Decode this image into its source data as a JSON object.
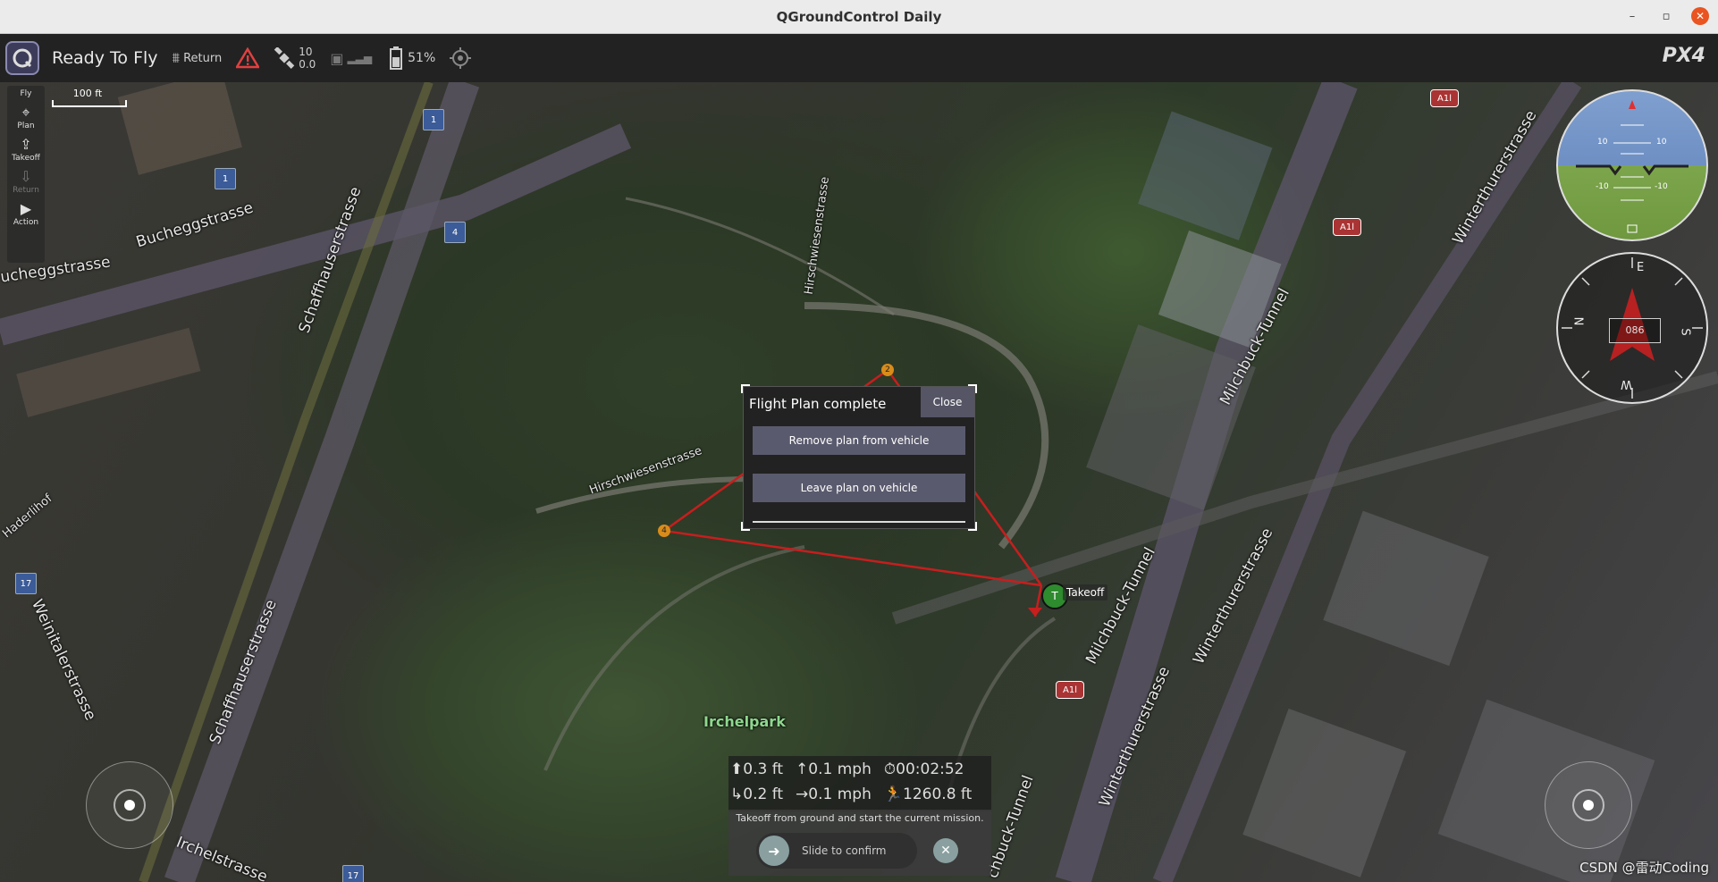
{
  "window": {
    "title": "QGroundControl Daily"
  },
  "toolbar": {
    "status": "Ready To Fly",
    "return_label": "Return",
    "satellite_count": "10",
    "satellite_hdop": "0.0",
    "battery_percent": "51%"
  },
  "fly_tools": [
    {
      "label": "Fly",
      "icon": "fly-icon",
      "enabled": true
    },
    {
      "label": "Plan",
      "icon": "plan-icon",
      "enabled": true
    },
    {
      "label": "Takeoff",
      "icon": "takeoff-icon",
      "enabled": true
    },
    {
      "label": "Return",
      "icon": "return-icon",
      "enabled": false
    },
    {
      "label": "Action",
      "icon": "action-icon",
      "enabled": true
    }
  ],
  "scale": {
    "label": "100 ft"
  },
  "map": {
    "streets": [
      "Bucheggstrasse",
      "ucheggstrasse",
      "Schaffhauserstrasse",
      "Schaffhauserstrasse",
      "Hirschwiesenstrasse",
      "Hirschwiesenstrasse",
      "Milchbuck-Tunnel",
      "Milchbuck-Tunnel",
      "Winterthurerstrasse",
      "Winterthurerstrasse",
      "Winterthurerstrasse",
      "Weinitalerstrasse",
      "Haderlihof",
      "Irchelstrasse",
      "chbuck-Tunnel"
    ],
    "park_label": "Irchelpark",
    "badges_blue": [
      "1",
      "1",
      "4",
      "17",
      "17"
    ],
    "badges_red": [
      "A1l",
      "A1l",
      "A1l"
    ],
    "waypoints": [
      "2",
      "4"
    ],
    "takeoff": {
      "marker": "T",
      "label": "Takeoff"
    }
  },
  "instruments": {
    "pitch_marks": [
      "10",
      "10",
      "-10",
      "-10"
    ],
    "compass_points": [
      "N",
      "E",
      "S",
      "W"
    ],
    "heading": "086"
  },
  "dialog": {
    "title": "Flight Plan complete",
    "close_label": "Close",
    "remove_label": "Remove plan from vehicle",
    "leave_label": "Leave plan on vehicle"
  },
  "telemetry": {
    "altitude": "0.3 ft",
    "vertical_speed": "0.1 mph",
    "flight_time": "00:02:52",
    "distance_home_alt": "0.2 ft",
    "horizontal_speed": "0.1 mph",
    "distance": "1260.8 ft"
  },
  "confirm": {
    "message": "Takeoff from ground and start the current mission.",
    "slider_label": "Slide to confirm"
  },
  "watermark": "CSDN @雷动Coding"
}
